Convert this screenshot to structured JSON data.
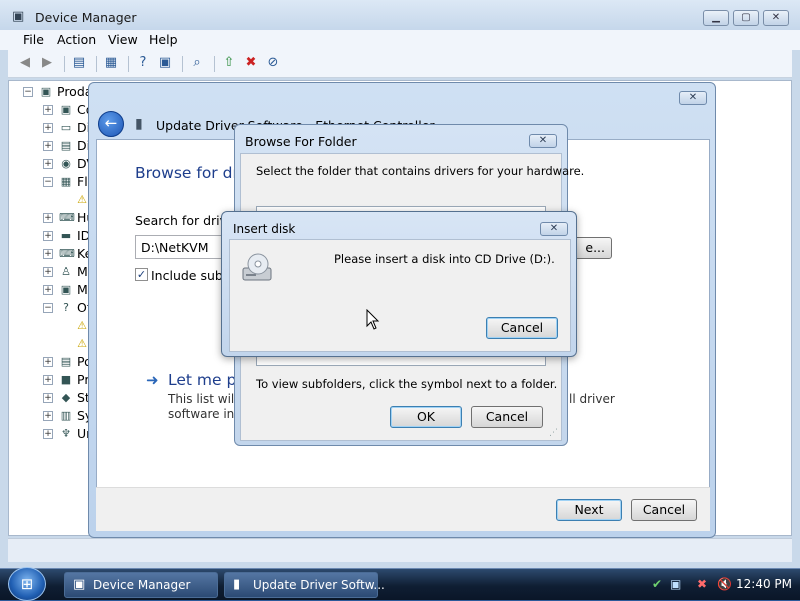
{
  "device_manager": {
    "title": "Device Manager",
    "menu": [
      "File",
      "Action",
      "View",
      "Help"
    ],
    "root_label": "Proda",
    "tree": [
      {
        "label": "Co",
        "icon": "computer-icon",
        "glyph": "▣",
        "state": "+"
      },
      {
        "label": "Di",
        "icon": "disk-drive-icon",
        "glyph": "▭",
        "state": "+"
      },
      {
        "label": "Di",
        "icon": "display-adapter-icon",
        "glyph": "▤",
        "state": "+"
      },
      {
        "label": "DV",
        "icon": "dvd-drive-icon",
        "glyph": "◉",
        "state": "+"
      },
      {
        "label": "Fl",
        "icon": "floppy-controller-icon",
        "glyph": "▦",
        "state": "−"
      },
      {
        "label": "",
        "icon": "warning-device-icon",
        "glyph": "⚠",
        "state": ""
      },
      {
        "label": "Hu",
        "icon": "hid-icon",
        "glyph": "⌨",
        "state": "+"
      },
      {
        "label": "ID",
        "icon": "ide-controller-icon",
        "glyph": "▬",
        "state": "+"
      },
      {
        "label": "Ke",
        "icon": "keyboard-icon",
        "glyph": "⌨",
        "state": "+"
      },
      {
        "label": "M",
        "icon": "mouse-icon",
        "glyph": "♙",
        "state": "+"
      },
      {
        "label": "M",
        "icon": "monitor-icon",
        "glyph": "▣",
        "state": "+"
      },
      {
        "label": "Ot",
        "icon": "other-devices-icon",
        "glyph": "?",
        "state": "−"
      },
      {
        "label": "",
        "icon": "warning-device-icon",
        "glyph": "⚠",
        "state": ""
      },
      {
        "label": "",
        "icon": "warning-device-icon",
        "glyph": "⚠",
        "state": ""
      },
      {
        "label": "Po",
        "icon": "ports-icon",
        "glyph": "▤",
        "state": "+"
      },
      {
        "label": "Pr",
        "icon": "processor-icon",
        "glyph": "■",
        "state": "+"
      },
      {
        "label": "St",
        "icon": "storage-controller-icon",
        "glyph": "◆",
        "state": "+"
      },
      {
        "label": "Sy",
        "icon": "system-devices-icon",
        "glyph": "▥",
        "state": "+"
      },
      {
        "label": "Ur",
        "icon": "usb-controller-icon",
        "glyph": "♆",
        "state": "+"
      }
    ]
  },
  "update_driver": {
    "title": "Update Driver Software - Ethernet Controller",
    "heading": "Browse for dri",
    "search_label": "Search for driver",
    "path_value": "D:\\NetKVM",
    "browse_button_tail": "e...",
    "include_subfolders": "Include subfo",
    "let_me_pick": "Let me pi",
    "desc_line1": "This list will s",
    "desc_line1_end": "ll driver",
    "desc_line2": "software in t",
    "next_button": "Next",
    "cancel_button": "Cancel"
  },
  "browse_folder": {
    "title": "Browse For Folder",
    "instruction": "Select the folder that contains drivers for your hardware.",
    "hint": "To view subfolders, click the symbol next to a folder.",
    "ok_button": "OK",
    "cancel_button": "Cancel"
  },
  "insert_disk": {
    "title": "Insert disk",
    "message": "Please insert a disk into CD Drive (D:).",
    "cancel_button": "Cancel"
  },
  "taskbar": {
    "items": [
      {
        "label": "Device Manager"
      },
      {
        "label": "Update Driver Softw..."
      }
    ],
    "clock": "12:40 PM"
  }
}
